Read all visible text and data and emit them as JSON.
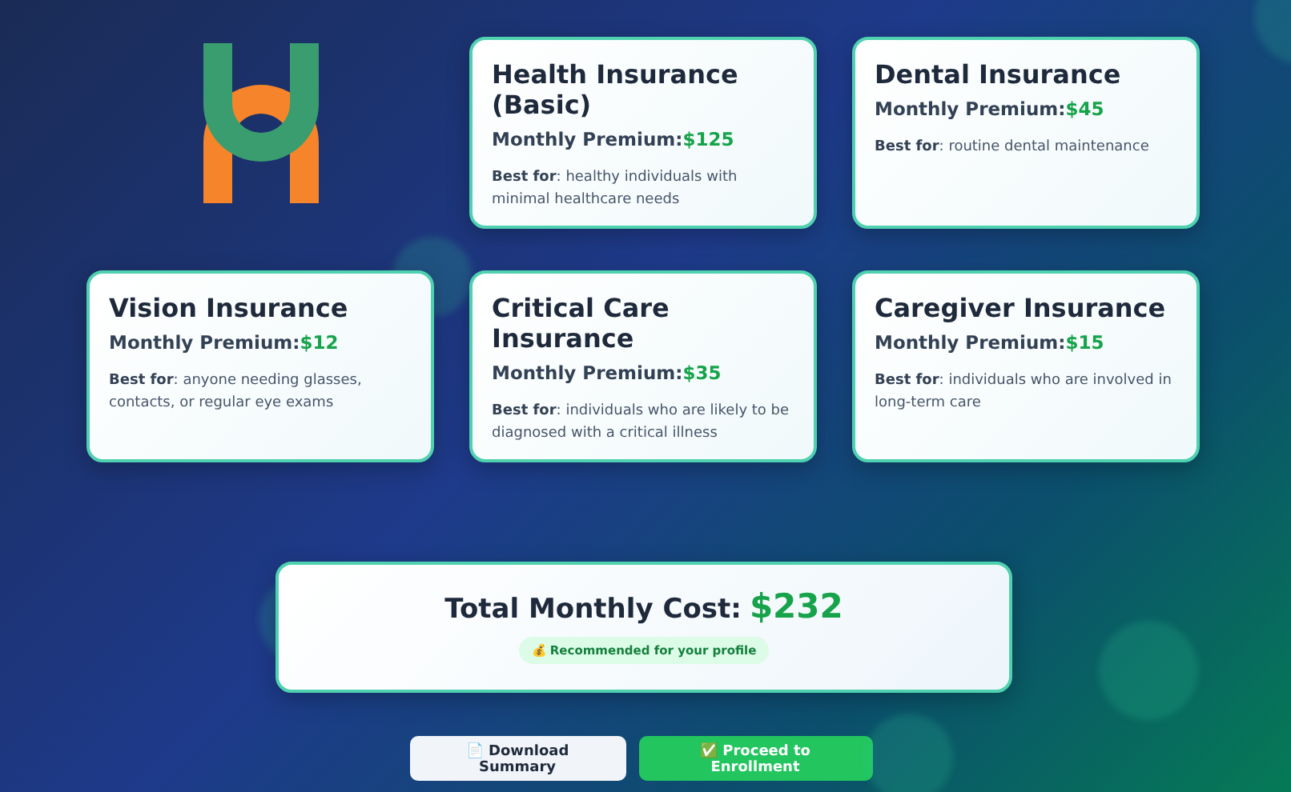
{
  "plans": [
    {
      "title": "Health Insurance (Basic)",
      "premium_label": "Monthly Premium:",
      "premium": "$125",
      "best_for_label": "Best for",
      "best_for": ": healthy individuals with minimal healthcare needs"
    },
    {
      "title": "Dental Insurance",
      "premium_label": "Monthly Premium:",
      "premium": "$45",
      "best_for_label": "Best for",
      "best_for": ": routine dental maintenance"
    },
    {
      "title": "Vision Insurance",
      "premium_label": "Monthly Premium:",
      "premium": "$12",
      "best_for_label": "Best for",
      "best_for": ": anyone needing glasses, contacts, or regular eye exams"
    },
    {
      "title": "Critical Care Insurance",
      "premium_label": "Monthly Premium:",
      "premium": "$35",
      "best_for_label": "Best for",
      "best_for": ": individuals who are likely to be diagnosed with a critical illness"
    },
    {
      "title": "Caregiver Insurance",
      "premium_label": "Monthly Premium:",
      "premium": "$15",
      "best_for_label": "Best for",
      "best_for": ": individuals who are involved in long-term care"
    }
  ],
  "total": {
    "label": "Total Monthly Cost:",
    "amount": "$232",
    "badge": "💰 Recommended for your profile"
  },
  "buttons": [
    {
      "label": "📄 Download Summary",
      "kind": "secondary"
    },
    {
      "label": "✅ Proceed to Enrollment",
      "kind": "primary"
    }
  ]
}
